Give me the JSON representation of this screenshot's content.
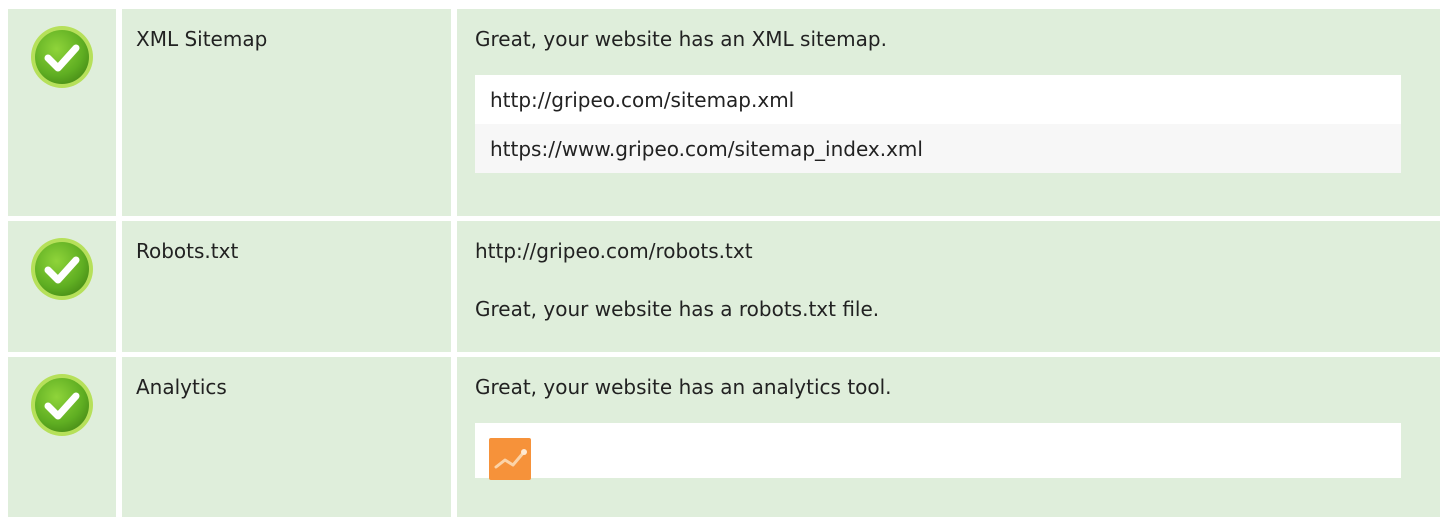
{
  "rows": [
    {
      "label": "XML Sitemap",
      "message": "Great, your website has an XML sitemap.",
      "urls": [
        "http://gripeo.com/sitemap.xml",
        "https://www.gripeo.com/sitemap_index.xml"
      ]
    },
    {
      "label": "Robots.txt",
      "url": "http://gripeo.com/robots.txt",
      "message": "Great, your website has a robots.txt file."
    },
    {
      "label": "Analytics",
      "message": "Great, your website has an analytics tool.",
      "tool_icon": "google-analytics-logo-icon"
    }
  ],
  "colors": {
    "row_bg": "#dfeedb",
    "check_green": "#6dbf2a",
    "check_rim": "#9ed83f"
  }
}
